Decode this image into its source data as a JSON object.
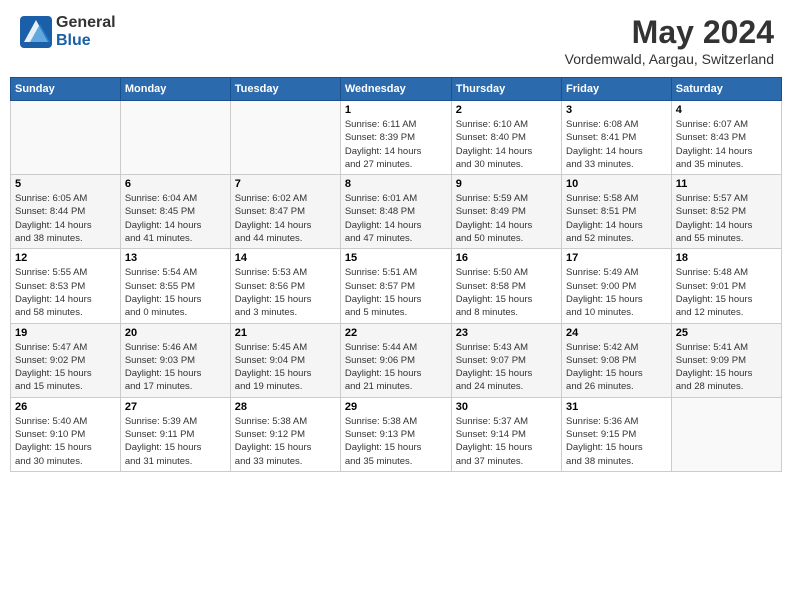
{
  "logo": {
    "general": "General",
    "blue": "Blue"
  },
  "title": "May 2024",
  "location": "Vordemwald, Aargau, Switzerland",
  "weekdays": [
    "Sunday",
    "Monday",
    "Tuesday",
    "Wednesday",
    "Thursday",
    "Friday",
    "Saturday"
  ],
  "weeks": [
    [
      {
        "day": "",
        "info": ""
      },
      {
        "day": "",
        "info": ""
      },
      {
        "day": "",
        "info": ""
      },
      {
        "day": "1",
        "info": "Sunrise: 6:11 AM\nSunset: 8:39 PM\nDaylight: 14 hours\nand 27 minutes."
      },
      {
        "day": "2",
        "info": "Sunrise: 6:10 AM\nSunset: 8:40 PM\nDaylight: 14 hours\nand 30 minutes."
      },
      {
        "day": "3",
        "info": "Sunrise: 6:08 AM\nSunset: 8:41 PM\nDaylight: 14 hours\nand 33 minutes."
      },
      {
        "day": "4",
        "info": "Sunrise: 6:07 AM\nSunset: 8:43 PM\nDaylight: 14 hours\nand 35 minutes."
      }
    ],
    [
      {
        "day": "5",
        "info": "Sunrise: 6:05 AM\nSunset: 8:44 PM\nDaylight: 14 hours\nand 38 minutes."
      },
      {
        "day": "6",
        "info": "Sunrise: 6:04 AM\nSunset: 8:45 PM\nDaylight: 14 hours\nand 41 minutes."
      },
      {
        "day": "7",
        "info": "Sunrise: 6:02 AM\nSunset: 8:47 PM\nDaylight: 14 hours\nand 44 minutes."
      },
      {
        "day": "8",
        "info": "Sunrise: 6:01 AM\nSunset: 8:48 PM\nDaylight: 14 hours\nand 47 minutes."
      },
      {
        "day": "9",
        "info": "Sunrise: 5:59 AM\nSunset: 8:49 PM\nDaylight: 14 hours\nand 50 minutes."
      },
      {
        "day": "10",
        "info": "Sunrise: 5:58 AM\nSunset: 8:51 PM\nDaylight: 14 hours\nand 52 minutes."
      },
      {
        "day": "11",
        "info": "Sunrise: 5:57 AM\nSunset: 8:52 PM\nDaylight: 14 hours\nand 55 minutes."
      }
    ],
    [
      {
        "day": "12",
        "info": "Sunrise: 5:55 AM\nSunset: 8:53 PM\nDaylight: 14 hours\nand 58 minutes."
      },
      {
        "day": "13",
        "info": "Sunrise: 5:54 AM\nSunset: 8:55 PM\nDaylight: 15 hours\nand 0 minutes."
      },
      {
        "day": "14",
        "info": "Sunrise: 5:53 AM\nSunset: 8:56 PM\nDaylight: 15 hours\nand 3 minutes."
      },
      {
        "day": "15",
        "info": "Sunrise: 5:51 AM\nSunset: 8:57 PM\nDaylight: 15 hours\nand 5 minutes."
      },
      {
        "day": "16",
        "info": "Sunrise: 5:50 AM\nSunset: 8:58 PM\nDaylight: 15 hours\nand 8 minutes."
      },
      {
        "day": "17",
        "info": "Sunrise: 5:49 AM\nSunset: 9:00 PM\nDaylight: 15 hours\nand 10 minutes."
      },
      {
        "day": "18",
        "info": "Sunrise: 5:48 AM\nSunset: 9:01 PM\nDaylight: 15 hours\nand 12 minutes."
      }
    ],
    [
      {
        "day": "19",
        "info": "Sunrise: 5:47 AM\nSunset: 9:02 PM\nDaylight: 15 hours\nand 15 minutes."
      },
      {
        "day": "20",
        "info": "Sunrise: 5:46 AM\nSunset: 9:03 PM\nDaylight: 15 hours\nand 17 minutes."
      },
      {
        "day": "21",
        "info": "Sunrise: 5:45 AM\nSunset: 9:04 PM\nDaylight: 15 hours\nand 19 minutes."
      },
      {
        "day": "22",
        "info": "Sunrise: 5:44 AM\nSunset: 9:06 PM\nDaylight: 15 hours\nand 21 minutes."
      },
      {
        "day": "23",
        "info": "Sunrise: 5:43 AM\nSunset: 9:07 PM\nDaylight: 15 hours\nand 24 minutes."
      },
      {
        "day": "24",
        "info": "Sunrise: 5:42 AM\nSunset: 9:08 PM\nDaylight: 15 hours\nand 26 minutes."
      },
      {
        "day": "25",
        "info": "Sunrise: 5:41 AM\nSunset: 9:09 PM\nDaylight: 15 hours\nand 28 minutes."
      }
    ],
    [
      {
        "day": "26",
        "info": "Sunrise: 5:40 AM\nSunset: 9:10 PM\nDaylight: 15 hours\nand 30 minutes."
      },
      {
        "day": "27",
        "info": "Sunrise: 5:39 AM\nSunset: 9:11 PM\nDaylight: 15 hours\nand 31 minutes."
      },
      {
        "day": "28",
        "info": "Sunrise: 5:38 AM\nSunset: 9:12 PM\nDaylight: 15 hours\nand 33 minutes."
      },
      {
        "day": "29",
        "info": "Sunrise: 5:38 AM\nSunset: 9:13 PM\nDaylight: 15 hours\nand 35 minutes."
      },
      {
        "day": "30",
        "info": "Sunrise: 5:37 AM\nSunset: 9:14 PM\nDaylight: 15 hours\nand 37 minutes."
      },
      {
        "day": "31",
        "info": "Sunrise: 5:36 AM\nSunset: 9:15 PM\nDaylight: 15 hours\nand 38 minutes."
      },
      {
        "day": "",
        "info": ""
      }
    ]
  ]
}
